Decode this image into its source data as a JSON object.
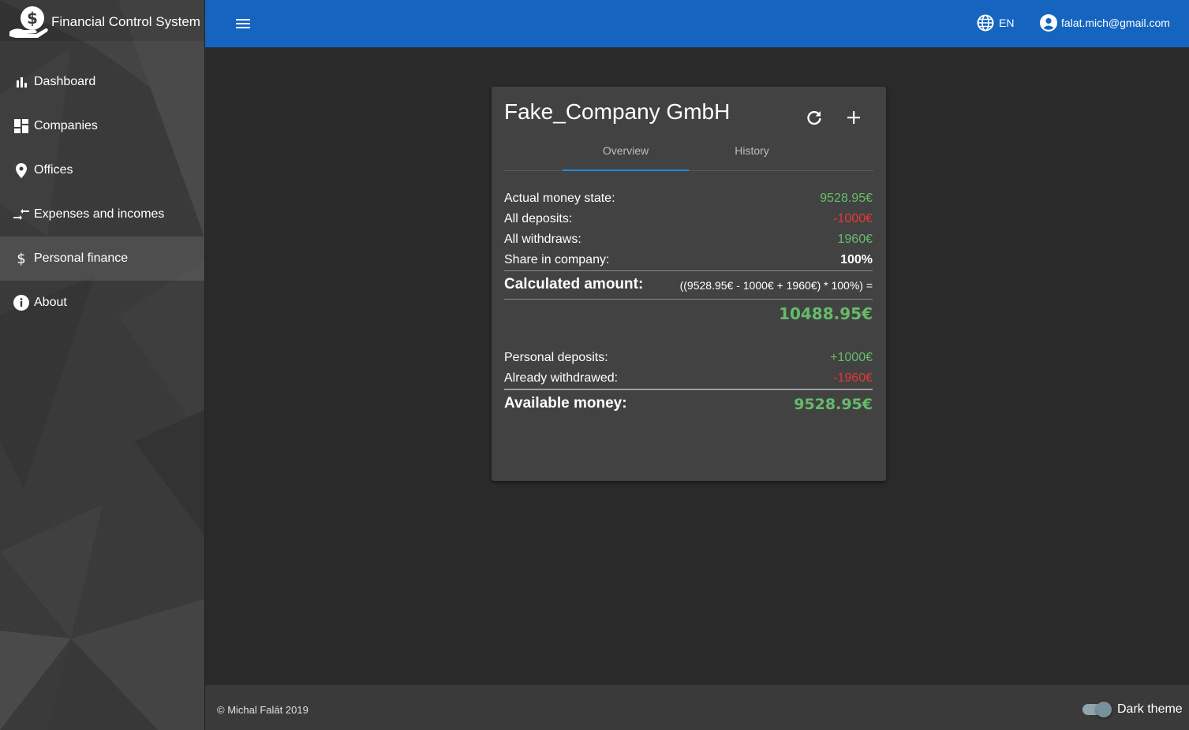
{
  "app": {
    "title": "Financial Control System"
  },
  "sidebar": {
    "items": [
      {
        "label": "Dashboard",
        "icon": "bar-chart-icon"
      },
      {
        "label": "Companies",
        "icon": "dashboard-icon"
      },
      {
        "label": "Offices",
        "icon": "location-pin-icon"
      },
      {
        "label": "Expenses and incomes",
        "icon": "compare-arrows-icon"
      },
      {
        "label": "Personal finance",
        "icon": "dollar-icon",
        "active": true
      },
      {
        "label": "About",
        "icon": "info-icon"
      }
    ]
  },
  "header": {
    "language": "EN",
    "user_email": "falat.mich@gmail.com"
  },
  "card": {
    "title": "Fake_Company GmbH",
    "tabs": [
      {
        "label": "Overview",
        "active": true
      },
      {
        "label": "History",
        "active": false
      }
    ],
    "actual_money_label": "Actual money state:",
    "actual_money_value": "9528.95€",
    "all_deposits_label": "All deposits:",
    "all_deposits_value": "-1000€",
    "all_withdraws_label": "All withdraws:",
    "all_withdraws_value": "1960€",
    "share_label": "Share in company:",
    "share_value": "100%",
    "calculated_label": "Calculated amount:",
    "calculated_formula": "((9528.95€ - 1000€ + 1960€) * 100%) =",
    "calculated_result": "10488.95€",
    "personal_deposits_label": "Personal deposits:",
    "personal_deposits_value": "+1000€",
    "already_withdrawed_label": "Already withdrawed:",
    "already_withdrawed_value": "-1960€",
    "available_label": "Available money:",
    "available_value": "9528.95€"
  },
  "footer": {
    "copyright": "© Michal Falát 2019",
    "theme_label": "Dark theme",
    "dark_theme_enabled": true
  },
  "colors": {
    "primary": "#1565c0",
    "positive": "#66bb6a",
    "negative": "#e53935",
    "tab_indicator": "#1e88e5"
  }
}
